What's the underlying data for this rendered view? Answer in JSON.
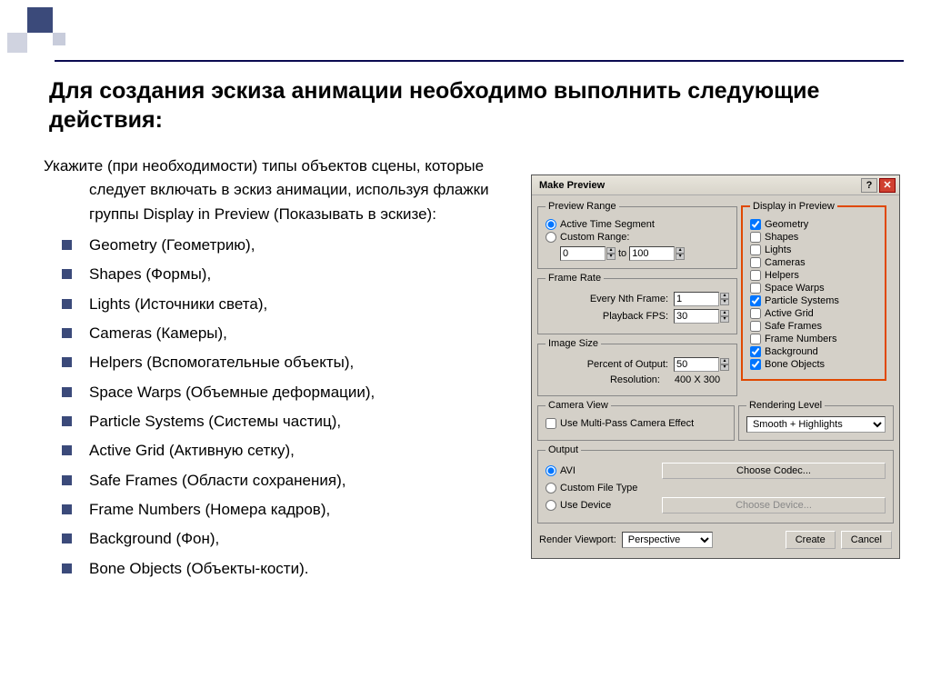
{
  "slide": {
    "title": "Для создания эскиза анимации необходимо выполнить следующие действия:",
    "intro": "Укажите (при необходимости) типы объектов сцены, которые следует включать в эскиз анимации, используя флажки группы Display in Preview (Показывать в эскизе):",
    "bullets": [
      "Geometry (Геометрию),",
      " Shapes (Формы),",
      "Lights (Источники света),",
      "Cameras (Камеры),",
      " Helpers (Вспомогательные объекты),",
      "Space Warps (Объемные деформации),",
      " Particle Systems (Системы частиц),",
      "Active Grid (Активную сетку),",
      "Safe Frames (Области сохранения),",
      "Frame Numbers (Номера кадров),",
      " Background (Фон),",
      "Bone Objects (Объекты-кости)."
    ]
  },
  "dialog": {
    "title": "Make Preview",
    "previewRange": {
      "legend": "Preview Range",
      "active": "Active Time Segment",
      "custom": "Custom Range:",
      "from": "0",
      "to_label": "to",
      "to": "100"
    },
    "frameRate": {
      "legend": "Frame Rate",
      "nth_label": "Every Nth Frame:",
      "nth": "1",
      "fps_label": "Playback FPS:",
      "fps": "30"
    },
    "imageSize": {
      "legend": "Image Size",
      "percent_label": "Percent of Output:",
      "percent": "50",
      "res_label": "Resolution:",
      "res_value": "400  X  300"
    },
    "cameraView": {
      "legend": "Camera View",
      "multipass": "Use Multi-Pass Camera Effect"
    },
    "displayInPreview": {
      "legend": "Display in Preview",
      "items": [
        {
          "label": "Geometry",
          "checked": true
        },
        {
          "label": "Shapes",
          "checked": false
        },
        {
          "label": "Lights",
          "checked": false
        },
        {
          "label": "Cameras",
          "checked": false
        },
        {
          "label": "Helpers",
          "checked": false
        },
        {
          "label": "Space Warps",
          "checked": false
        },
        {
          "label": "Particle Systems",
          "checked": true
        },
        {
          "label": "Active Grid",
          "checked": false
        },
        {
          "label": "Safe Frames",
          "checked": false
        },
        {
          "label": "Frame Numbers",
          "checked": false
        },
        {
          "label": "Background",
          "checked": true
        },
        {
          "label": "Bone Objects",
          "checked": true
        }
      ]
    },
    "renderingLevel": {
      "legend": "Rendering Level",
      "value": "Smooth + Highlights"
    },
    "output": {
      "legend": "Output",
      "avi": "AVI",
      "codec_btn": "Choose Codec...",
      "custom": "Custom File Type",
      "device": "Use Device",
      "device_btn": "Choose Device..."
    },
    "footer": {
      "viewport_label": "Render Viewport:",
      "viewport_value": "Perspective",
      "create": "Create",
      "cancel": "Cancel"
    }
  }
}
